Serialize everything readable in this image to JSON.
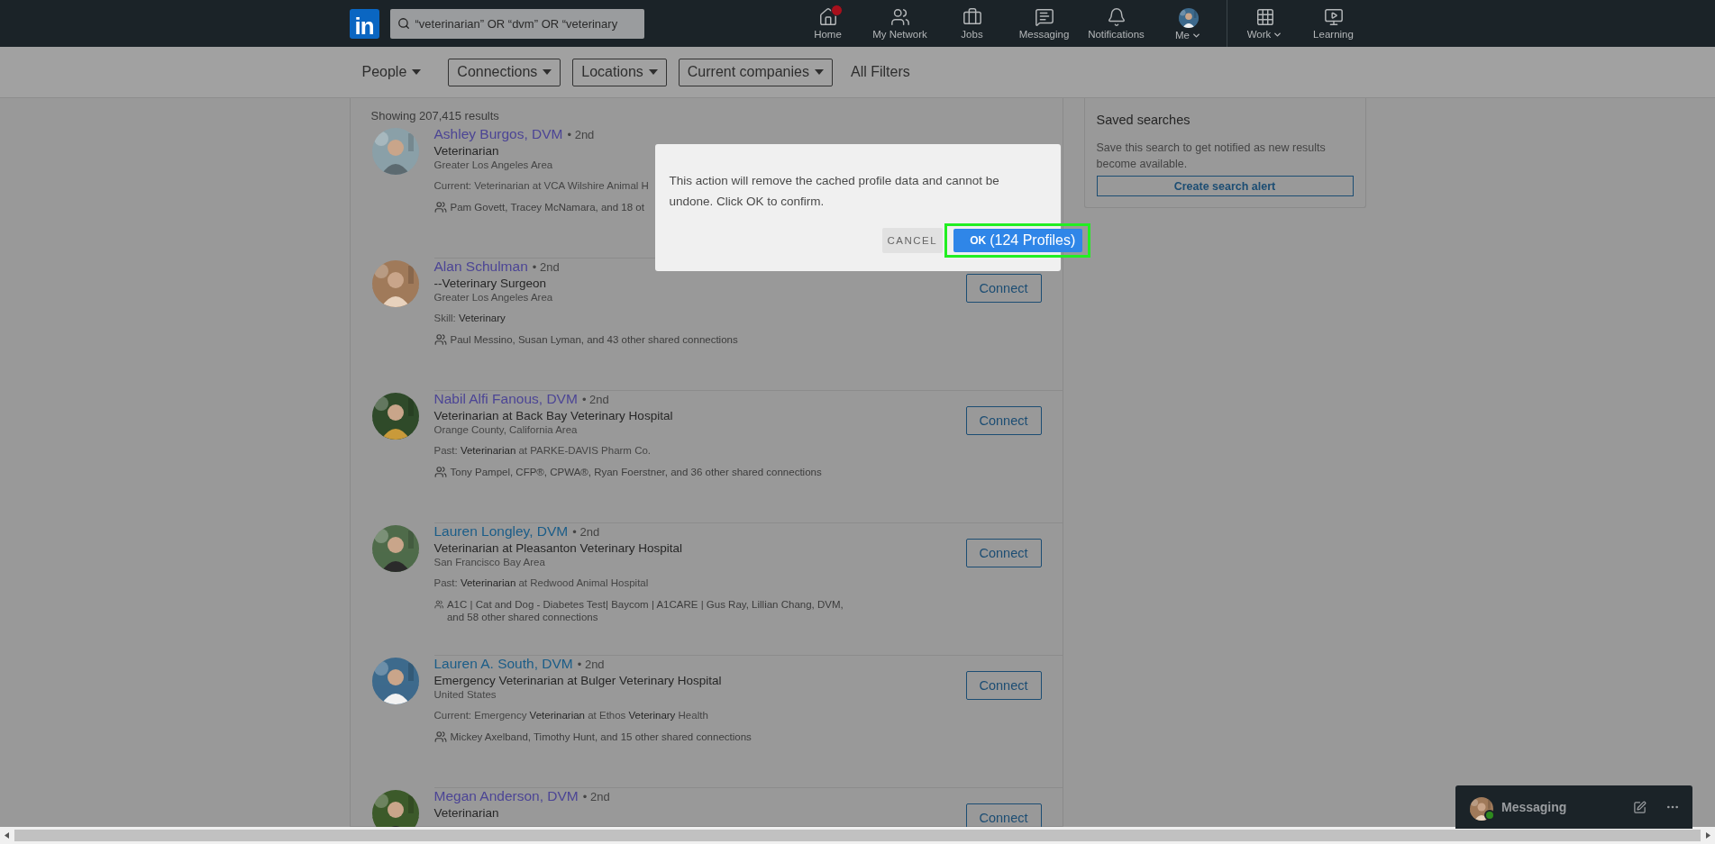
{
  "nav": {
    "logo": "in",
    "search": {
      "value": "“veterinarian” OR “dvm” OR “veterinary"
    },
    "items": [
      {
        "kind": "home",
        "label": "Home",
        "has_badge": true,
        "dropdown": false
      },
      {
        "kind": "network",
        "label": "My Network",
        "has_badge": false,
        "dropdown": false
      },
      {
        "kind": "jobs",
        "label": "Jobs",
        "has_badge": false,
        "dropdown": false
      },
      {
        "kind": "messaging",
        "label": "Messaging",
        "has_badge": false,
        "dropdown": false
      },
      {
        "kind": "notifications",
        "label": "Notifications",
        "has_badge": false,
        "dropdown": false
      },
      {
        "kind": "me",
        "label": "Me",
        "has_badge": false,
        "dropdown": true
      }
    ],
    "more_items": [
      {
        "kind": "work",
        "label": "Work",
        "has_badge": false,
        "dropdown": true
      },
      {
        "kind": "learning",
        "label": "Learning",
        "has_badge": false,
        "dropdown": false
      }
    ]
  },
  "filters": [
    {
      "label": "People",
      "boxed": false,
      "dropdown": true
    },
    {
      "label": "Connections",
      "boxed": true,
      "dropdown": true
    },
    {
      "label": "Locations",
      "boxed": true,
      "dropdown": true
    },
    {
      "label": "Current companies",
      "boxed": true,
      "dropdown": true
    },
    {
      "label": "All Filters",
      "boxed": false,
      "dropdown": false
    }
  ],
  "results": {
    "count": "Showing 207,415 results",
    "rows": [
      {
        "name": "Ashley Burgos, DVM",
        "visited": true,
        "degree": "• 2nd",
        "headline": "Veterinarian",
        "location": "Greater Los Angeles Area",
        "snippet": "Current: Veterinarian at VCA Wilshire Animal H",
        "shared": "Pam Govett, Tracey McNamara, and 18 ot"
      },
      {
        "name": "Alan Schulman",
        "visited": true,
        "degree": "• 2nd",
        "headline": "--Veterinary Surgeon",
        "location": "Greater Los Angeles Area",
        "snippet": "Skill: **Veterinary**",
        "shared": "Paul Messino, Susan Lyman, and 43 other shared connections",
        "connect": "Connect"
      },
      {
        "name": "Nabil Alfi Fanous, DVM",
        "visited": true,
        "degree": "• 2nd",
        "headline": "Veterinarian at Back Bay Veterinary Hospital",
        "location": "Orange County, California Area",
        "snippet": "Past: **Veterinarian** at PARKE-DAVIS Pharm Co.",
        "shared": "Tony Pampel, CFP®, CPWA®, Ryan Foerstner, and 36 other shared connections",
        "connect": "Connect"
      },
      {
        "name": "Lauren Longley, DVM",
        "visited": false,
        "degree": "• 2nd",
        "headline": "Veterinarian at Pleasanton Veterinary Hospital",
        "location": "San Francisco Bay Area",
        "snippet": "Past: **Veterinarian** at Redwood Animal Hospital",
        "shared": "A1C | Cat and Dog - Diabetes Test| Baycom | A1CARE | Gus Ray, Lillian Chang, DVM, and 58 other shared connections",
        "connect": "Connect"
      },
      {
        "name": "Lauren A. South, DVM",
        "visited": false,
        "degree": "• 2nd",
        "headline": "Emergency Veterinarian at Bulger Veterinary Hospital",
        "location": "United States",
        "snippet": "Current: Emergency **Veterinarian** at Ethos **Veterinary** Health",
        "shared": "Mickey Axelband, Timothy Hunt, and 15 other shared connections",
        "connect": "Connect"
      },
      {
        "name": "Megan Anderson, DVM",
        "visited": true,
        "degree": "• 2nd",
        "headline": "Veterinarian",
        "connect": "Connect"
      }
    ]
  },
  "saved_searches": {
    "title": "Saved searches",
    "text": "Save this search to get notified as new results become available.",
    "button": "Create search alert"
  },
  "dialog": {
    "message": "This action will remove the cached profile data and cannot be undone. Click OK to confirm.",
    "cancel": "CANCEL",
    "ok": "OK",
    "ok_count": "(124 Profiles)",
    "highlighted": true
  },
  "messaging": {
    "label": "Messaging",
    "online": true
  }
}
